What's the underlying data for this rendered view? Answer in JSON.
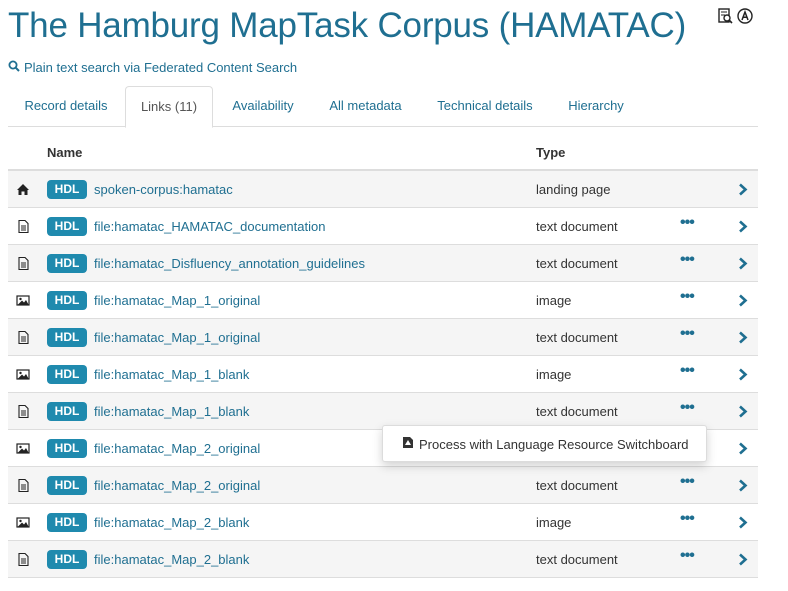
{
  "page": {
    "title": "The Hamburg MapTask Corpus (HAMATAC)",
    "fcs_link": "Plain text search via Federated Content Search"
  },
  "top_icons": [
    "document-search-icon",
    "accessibility-icon"
  ],
  "tabs": [
    {
      "label": "Record details",
      "active": false
    },
    {
      "label": "Links (11)",
      "active": true
    },
    {
      "label": "Availability",
      "active": false
    },
    {
      "label": "All metadata",
      "active": false
    },
    {
      "label": "Technical details",
      "active": false
    },
    {
      "label": "Hierarchy",
      "active": false
    }
  ],
  "table": {
    "headers": {
      "name": "Name",
      "type": "Type"
    },
    "hdl_label": "HDL",
    "rows": [
      {
        "icon": "home-icon",
        "name": "spoken-corpus:hamatac",
        "type": "landing page",
        "has_menu": false
      },
      {
        "icon": "document-icon",
        "name": "file:hamatac_HAMATAC_documentation",
        "type": "text document",
        "has_menu": true
      },
      {
        "icon": "document-icon",
        "name": "file:hamatac_Disfluency_annotation_guidelines",
        "type": "text document",
        "has_menu": true
      },
      {
        "icon": "image-icon",
        "name": "file:hamatac_Map_1_original",
        "type": "image",
        "has_menu": true
      },
      {
        "icon": "document-icon",
        "name": "file:hamatac_Map_1_original",
        "type": "text document",
        "has_menu": true
      },
      {
        "icon": "image-icon",
        "name": "file:hamatac_Map_1_blank",
        "type": "image",
        "has_menu": true
      },
      {
        "icon": "document-icon",
        "name": "file:hamatac_Map_1_blank",
        "type": "text document",
        "has_menu": true
      },
      {
        "icon": "image-icon",
        "name": "file:hamatac_Map_2_original",
        "type": "image",
        "has_menu": true
      },
      {
        "icon": "document-icon",
        "name": "file:hamatac_Map_2_original",
        "type": "text document",
        "has_menu": true
      },
      {
        "icon": "image-icon",
        "name": "file:hamatac_Map_2_blank",
        "type": "image",
        "has_menu": true
      },
      {
        "icon": "document-icon",
        "name": "file:hamatac_Map_2_blank",
        "type": "text document",
        "has_menu": true
      }
    ]
  },
  "dropdown": {
    "icon": "switchboard-icon",
    "label": "Process with Language Resource Switchboard"
  },
  "colors": {
    "link": "#1f6f91",
    "badge": "#1f8aae",
    "stripe": "#f5f5f5",
    "border": "#dddddd"
  }
}
